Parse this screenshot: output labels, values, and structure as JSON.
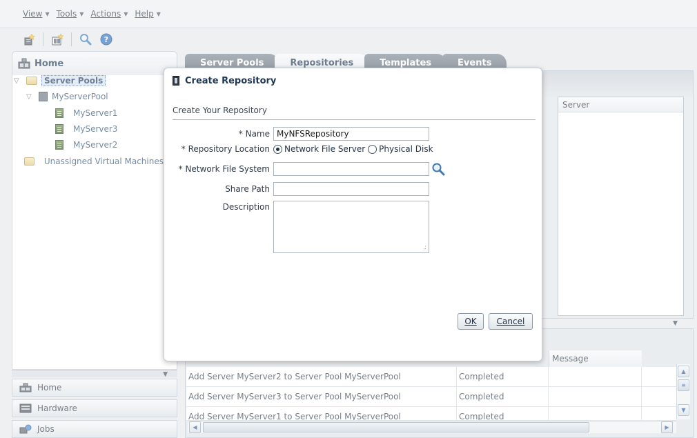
{
  "menubar": {
    "items": [
      {
        "label": "View"
      },
      {
        "label": "Tools"
      },
      {
        "label": "Actions"
      },
      {
        "label": "Help"
      }
    ]
  },
  "toolbar": {
    "icons": [
      "create-server-icon",
      "create-pool-icon",
      "search-icon",
      "help-icon"
    ]
  },
  "navigator": {
    "header": "Home",
    "tree": {
      "server_pools": "Server Pools",
      "pool": "MyServerPool",
      "servers": [
        "MyServer1",
        "MyServer3",
        "MyServer2"
      ],
      "unassigned": "Unassigned Virtual Machines"
    },
    "accordion": [
      "Home",
      "Hardware",
      "Jobs"
    ]
  },
  "tabs": [
    "Server Pools",
    "Repositories",
    "Templates",
    "Events"
  ],
  "repo_grid": {
    "column_header": "Server"
  },
  "jobs": {
    "column_header_message": "Message",
    "rows": [
      {
        "description": "Add Server MyServer2 to Server Pool MyServerPool",
        "status": "Completed"
      },
      {
        "description": "Add Server MyServer3 to Server Pool MyServerPool",
        "status": "Completed"
      },
      {
        "description": "Add Server MyServer1 to Server Pool MyServerPool",
        "status": "Completed"
      }
    ]
  },
  "dialog": {
    "title": "Create Repository",
    "section": "Create Your Repository",
    "fields": {
      "name_label": "* Name",
      "name_value": "MyNFSRepository",
      "location_label": "* Repository Location",
      "location_options": [
        "Network File Server",
        "Physical Disk"
      ],
      "location_selected": "Network File Server",
      "nfs_label": "* Network File System",
      "nfs_value": "",
      "share_label": "Share Path",
      "share_value": "",
      "desc_label": "Description",
      "desc_value": ""
    },
    "ok_label": "OK",
    "cancel_label": "Cancel"
  },
  "colors": {
    "accent": "#2a4d73",
    "tab_inactive": "#6b7681",
    "dialog_bg": "#ffffff"
  }
}
